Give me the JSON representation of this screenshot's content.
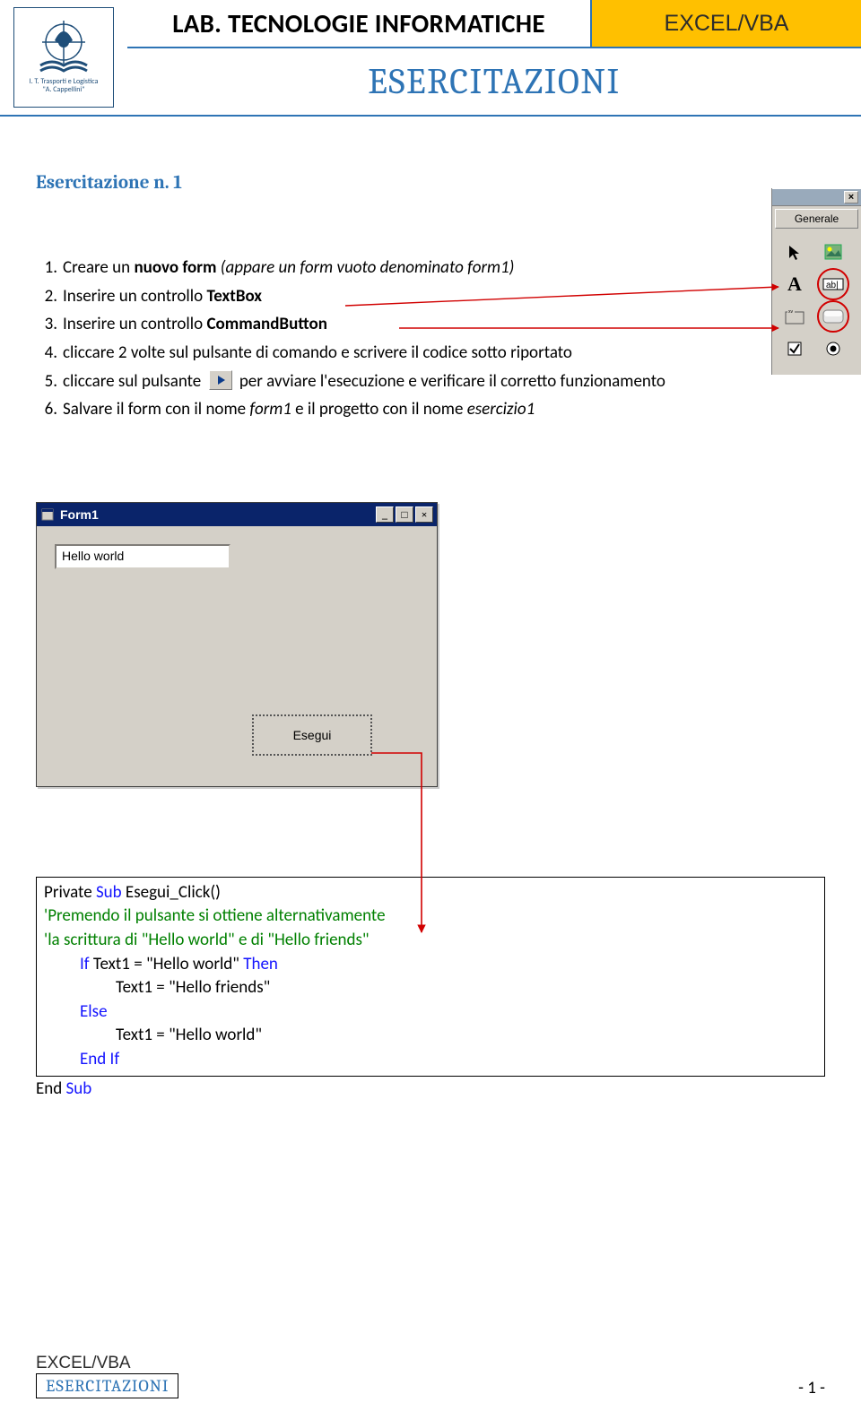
{
  "header": {
    "title": "LAB. TECNOLOGIE INFORMATICHE",
    "badge": "EXCEL/VBA",
    "subtitle": "ESERCITAZIONI",
    "logo_caption_line1": "I. T. Trasporti e Logistica",
    "logo_caption_line2": "\"A. Cappellini\""
  },
  "exercise_heading": "Esercitazione n. 1",
  "steps": [
    {
      "n": "1.",
      "pre": "Creare un ",
      "bold": "nuovo form",
      "post": " ",
      "italic": "(appare un form vuoto denominato form1)"
    },
    {
      "n": "2.",
      "pre": "Inserire un controllo ",
      "bold": "TextBox",
      "post": "",
      "italic": ""
    },
    {
      "n": "3.",
      "pre": "Inserire un controllo ",
      "bold": "CommandButton",
      "post": "",
      "italic": ""
    },
    {
      "n": "4.",
      "pre": "cliccare 2 volte sul pulsante di comando e scrivere il codice sotto riportato",
      "bold": "",
      "post": "",
      "italic": ""
    },
    {
      "n": "5.",
      "pre": "cliccare sul pulsante ",
      "bold": "",
      "post2": " per avviare l'esecuzione e verificare il corretto funzionamento",
      "with_run_btn": true
    },
    {
      "n": "6.",
      "pre": "Salvare il form con il nome ",
      "italic": "form1",
      "post": " e il progetto con il nome ",
      "italic2": "esercizio1"
    }
  ],
  "vb_form": {
    "title": "Form1",
    "textbox_value": "Hello world",
    "button_label": "Esegui",
    "title_buttons": {
      "min": "_",
      "max": "□",
      "close": "×"
    }
  },
  "toolbox": {
    "tab": "Generale",
    "tools": [
      {
        "name": "pointer-tool",
        "glyph": "pointer"
      },
      {
        "name": "picturebox-tool",
        "glyph": "picture"
      },
      {
        "name": "label-tool",
        "glyph": "A"
      },
      {
        "name": "textbox-tool",
        "glyph": "abl",
        "highlight": true
      },
      {
        "name": "frame-tool",
        "glyph": "frame"
      },
      {
        "name": "commandbutton-tool",
        "glyph": "button",
        "highlight": true
      },
      {
        "name": "checkbox-tool",
        "glyph": "check"
      },
      {
        "name": "optionbutton-tool",
        "glyph": "radio"
      }
    ]
  },
  "code": {
    "l1_a": "Private ",
    "l1_b": "Sub",
    "l1_c": " Esegui_Click()",
    "l2": "'Premendo il pulsante si ottiene alternativamente",
    "l3": "'la scrittura di \"Hello world\" e di \"Hello friends\"",
    "l4_a": "If",
    "l4_b": " Text1 = \"Hello world\" ",
    "l4_c": "Then",
    "l5": "Text1 = \"Hello friends\"",
    "l6": "Else",
    "l7": "Text1 = \"Hello world\"",
    "l8": "End If",
    "l9_a": "End ",
    "l9_b": "Sub"
  },
  "footer": {
    "badge": "EXCEL/VBA",
    "sub": "ESERCITAZIONI",
    "page": "- 1 -"
  }
}
